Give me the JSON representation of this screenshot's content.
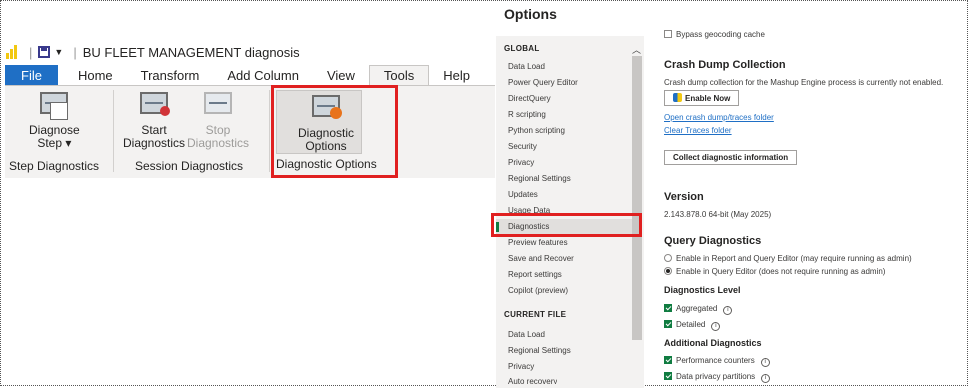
{
  "app": {
    "title": "BU FLEET MANAGEMENT diagnosis",
    "brand_color": "#f2c811"
  },
  "ribbon": {
    "tabs": [
      {
        "label": "File"
      },
      {
        "label": "Home"
      },
      {
        "label": "Transform"
      },
      {
        "label": "Add Column"
      },
      {
        "label": "View"
      },
      {
        "label": "Tools"
      },
      {
        "label": "Help"
      }
    ],
    "active_tab": "Tools",
    "groups": {
      "step": {
        "label": "Step Diagnostics",
        "diagnose_step_line1": "Diagnose",
        "diagnose_step_line2": "Step ▾"
      },
      "session": {
        "label": "Session Diagnostics",
        "start_line1": "Start",
        "start_line2": "Diagnostics",
        "stop_line1": "Stop",
        "stop_line2": "Diagnostics"
      },
      "options": {
        "label": "Diagnostic Options",
        "btn_line1": "Diagnostic",
        "btn_line2": "Options"
      }
    },
    "highlight_color": "#e02020"
  },
  "options_dialog": {
    "title": "Options",
    "nav": {
      "global_header": "GLOBAL",
      "global_items": [
        "Data Load",
        "Power Query Editor",
        "DirectQuery",
        "R scripting",
        "Python scripting",
        "Security",
        "Privacy",
        "Regional Settings",
        "Updates",
        "Usage Data",
        "Diagnostics",
        "Preview features",
        "Save and Recover",
        "Report settings",
        "Copilot (preview)"
      ],
      "selected": "Diagnostics",
      "current_header": "CURRENT FILE",
      "current_items": [
        "Data Load",
        "Regional Settings",
        "Privacy",
        "Auto recovery"
      ]
    },
    "content": {
      "bypass_label": "Bypass geocoding cache",
      "crash_title": "Crash Dump Collection",
      "crash_text": "Crash dump collection for the Mashup Engine process is currently not enabled.",
      "enable_now": "Enable Now",
      "open_folder": "Open crash dump/traces folder",
      "clear_traces": "Clear Traces folder",
      "collect_btn": "Collect diagnostic information",
      "version_title": "Version",
      "version_value": "2.143.878.0 64-bit (May 2025)",
      "query_title": "Query Diagnostics",
      "radio1": "Enable in Report and Query Editor (may require running as admin)",
      "radio2": "Enable in Query Editor (does not require running as admin)",
      "radio_selected": 2,
      "level_title": "Diagnostics Level",
      "aggregated": "Aggregated",
      "detailed": "Detailed",
      "additional_title": "Additional Diagnostics",
      "perf_counters": "Performance counters",
      "privacy_partitions": "Data privacy partitions",
      "info_glyph": "i"
    },
    "accent_green": "#107c41"
  }
}
